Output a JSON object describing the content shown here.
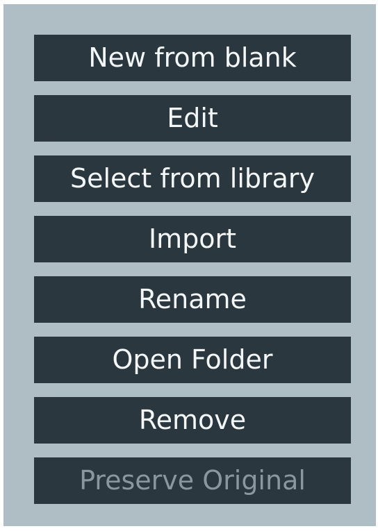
{
  "menu": {
    "items": [
      {
        "label": "New from blank"
      },
      {
        "label": "Edit"
      },
      {
        "label": "Select from library"
      },
      {
        "label": "Import"
      },
      {
        "label": "Rename"
      },
      {
        "label": "Open Folder"
      },
      {
        "label": "Remove"
      },
      {
        "label": "Preserve Original",
        "state": "disabled"
      }
    ]
  },
  "colors": {
    "panel_background": "#afbec5",
    "button_background": "#2a373e",
    "button_text": "#f4f7f8",
    "disabled_text": "#8a979e"
  }
}
